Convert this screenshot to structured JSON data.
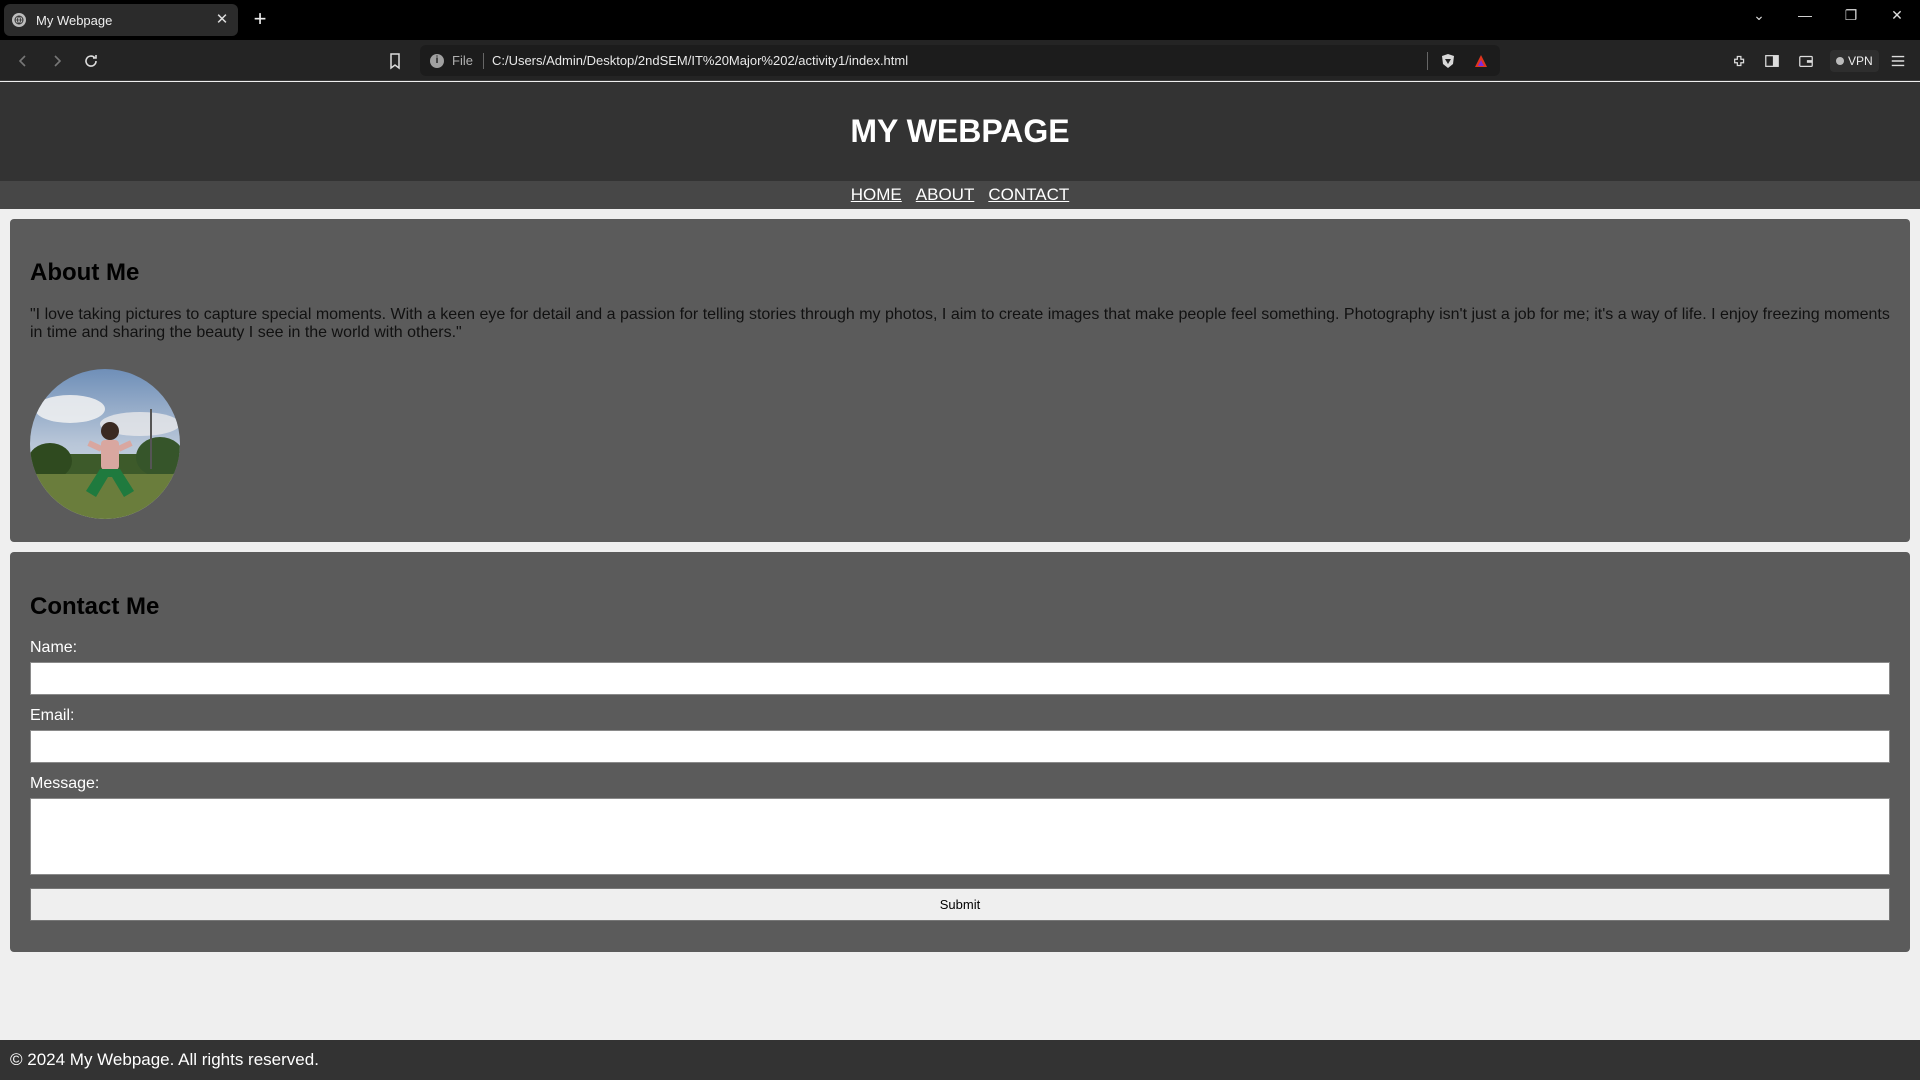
{
  "browser": {
    "tab_title": "My Webpage",
    "url_scheme_label": "File",
    "url": "C:/Users/Admin/Desktop/2ndSEM/IT%20Major%202/activity1/index.html",
    "vpn_label": "VPN"
  },
  "site": {
    "title": "MY WEBPAGE",
    "nav": [
      "HOME",
      "ABOUT",
      "CONTACT"
    ],
    "about": {
      "heading": "About Me",
      "text": "\"I love taking pictures to capture special moments. With a keen eye for detail and a passion for telling stories through my photos, I aim to create images that make people feel something. Photography isn't just a job for me; it's a way of life. I enjoy freezing moments in time and sharing the beauty I see in the world with others.\""
    },
    "contact": {
      "heading": "Contact Me",
      "name_label": "Name:",
      "email_label": "Email:",
      "message_label": "Message:",
      "submit_label": "Submit"
    },
    "footer": "© 2024 My Webpage. All rights reserved."
  },
  "colors": {
    "header_bg": "#333333",
    "nav_bg": "#474747",
    "section_bg": "#5b5b5b",
    "page_bg": "#efefef"
  }
}
